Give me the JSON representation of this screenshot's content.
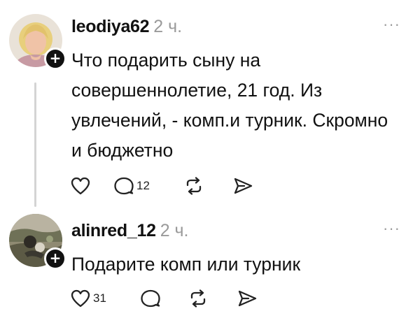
{
  "posts": [
    {
      "username": "leodiya62",
      "time": "2 ч.",
      "more": "···",
      "text": "Что подарить сыну на совершеннолетие, 21 год. Из увлечений, - комп.и турник. Скромно и бюджетно",
      "follow_badge": "+",
      "likes": "",
      "replies": "12"
    },
    {
      "username": "alinred_12",
      "time": "2 ч.",
      "more": "···",
      "text": "Подарите комп или турник",
      "follow_badge": "+",
      "likes": "31",
      "replies": ""
    }
  ],
  "icons": {
    "like": "heart-icon",
    "reply": "comment-icon",
    "repost": "repost-icon",
    "share": "send-icon",
    "more": "more-icon",
    "follow": "plus-icon"
  }
}
